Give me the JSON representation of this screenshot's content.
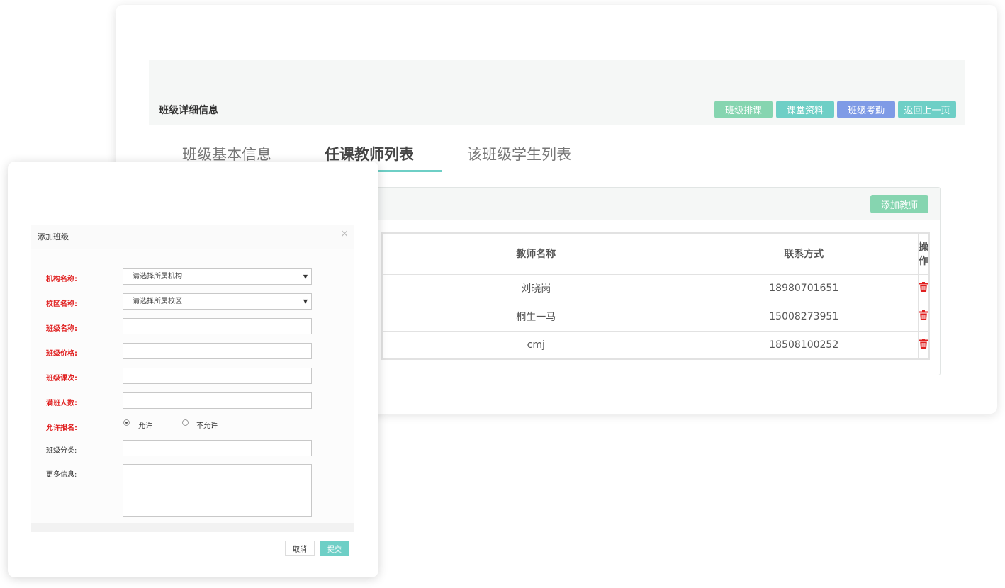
{
  "detail": {
    "title": "班级详细信息",
    "buttons": [
      {
        "label": "班级排课",
        "color": "#86d5b0"
      },
      {
        "label": "课堂资料",
        "color": "#6ecfc6"
      },
      {
        "label": "班级考勤",
        "color": "#7f9be6"
      },
      {
        "label": "返回上一页",
        "color": "#6ecfc6"
      }
    ],
    "tabs": [
      "班级基本信息",
      "任课教师列表",
      "该班级学生列表"
    ],
    "active_tab": "任课教师列表"
  },
  "teachers": {
    "add_button": "添加教师",
    "columns": [
      "教师名称",
      "联系方式",
      "操作"
    ],
    "rows": [
      {
        "name": "刘晓岗",
        "phone": "18980701651",
        "action_icon": "trash-icon"
      },
      {
        "name": "桐生一马",
        "phone": "15008273951",
        "action_icon": "trash-icon"
      },
      {
        "name": "cmj",
        "phone": "18508100252",
        "action_icon": "trash-icon"
      }
    ],
    "delete_color": "#e02020"
  },
  "modal": {
    "title": "添加班级",
    "close_icon": "close-icon",
    "fields": {
      "org_label": "机构名称:",
      "org_value": "请选择所属机构",
      "campus_label": "校区名称:",
      "campus_value": "请选择所属校区",
      "class_name_label": "班级名称:",
      "price_label": "班级价格:",
      "sessions_label": "班级课次:",
      "capacity_label": "满班人数:",
      "enroll_label": "允许报名:",
      "enroll_yes": "允许",
      "enroll_no": "不允许",
      "category_label": "班级分类:",
      "more_label": "更多信息:"
    },
    "cancel": "取消",
    "submit": "提交"
  }
}
